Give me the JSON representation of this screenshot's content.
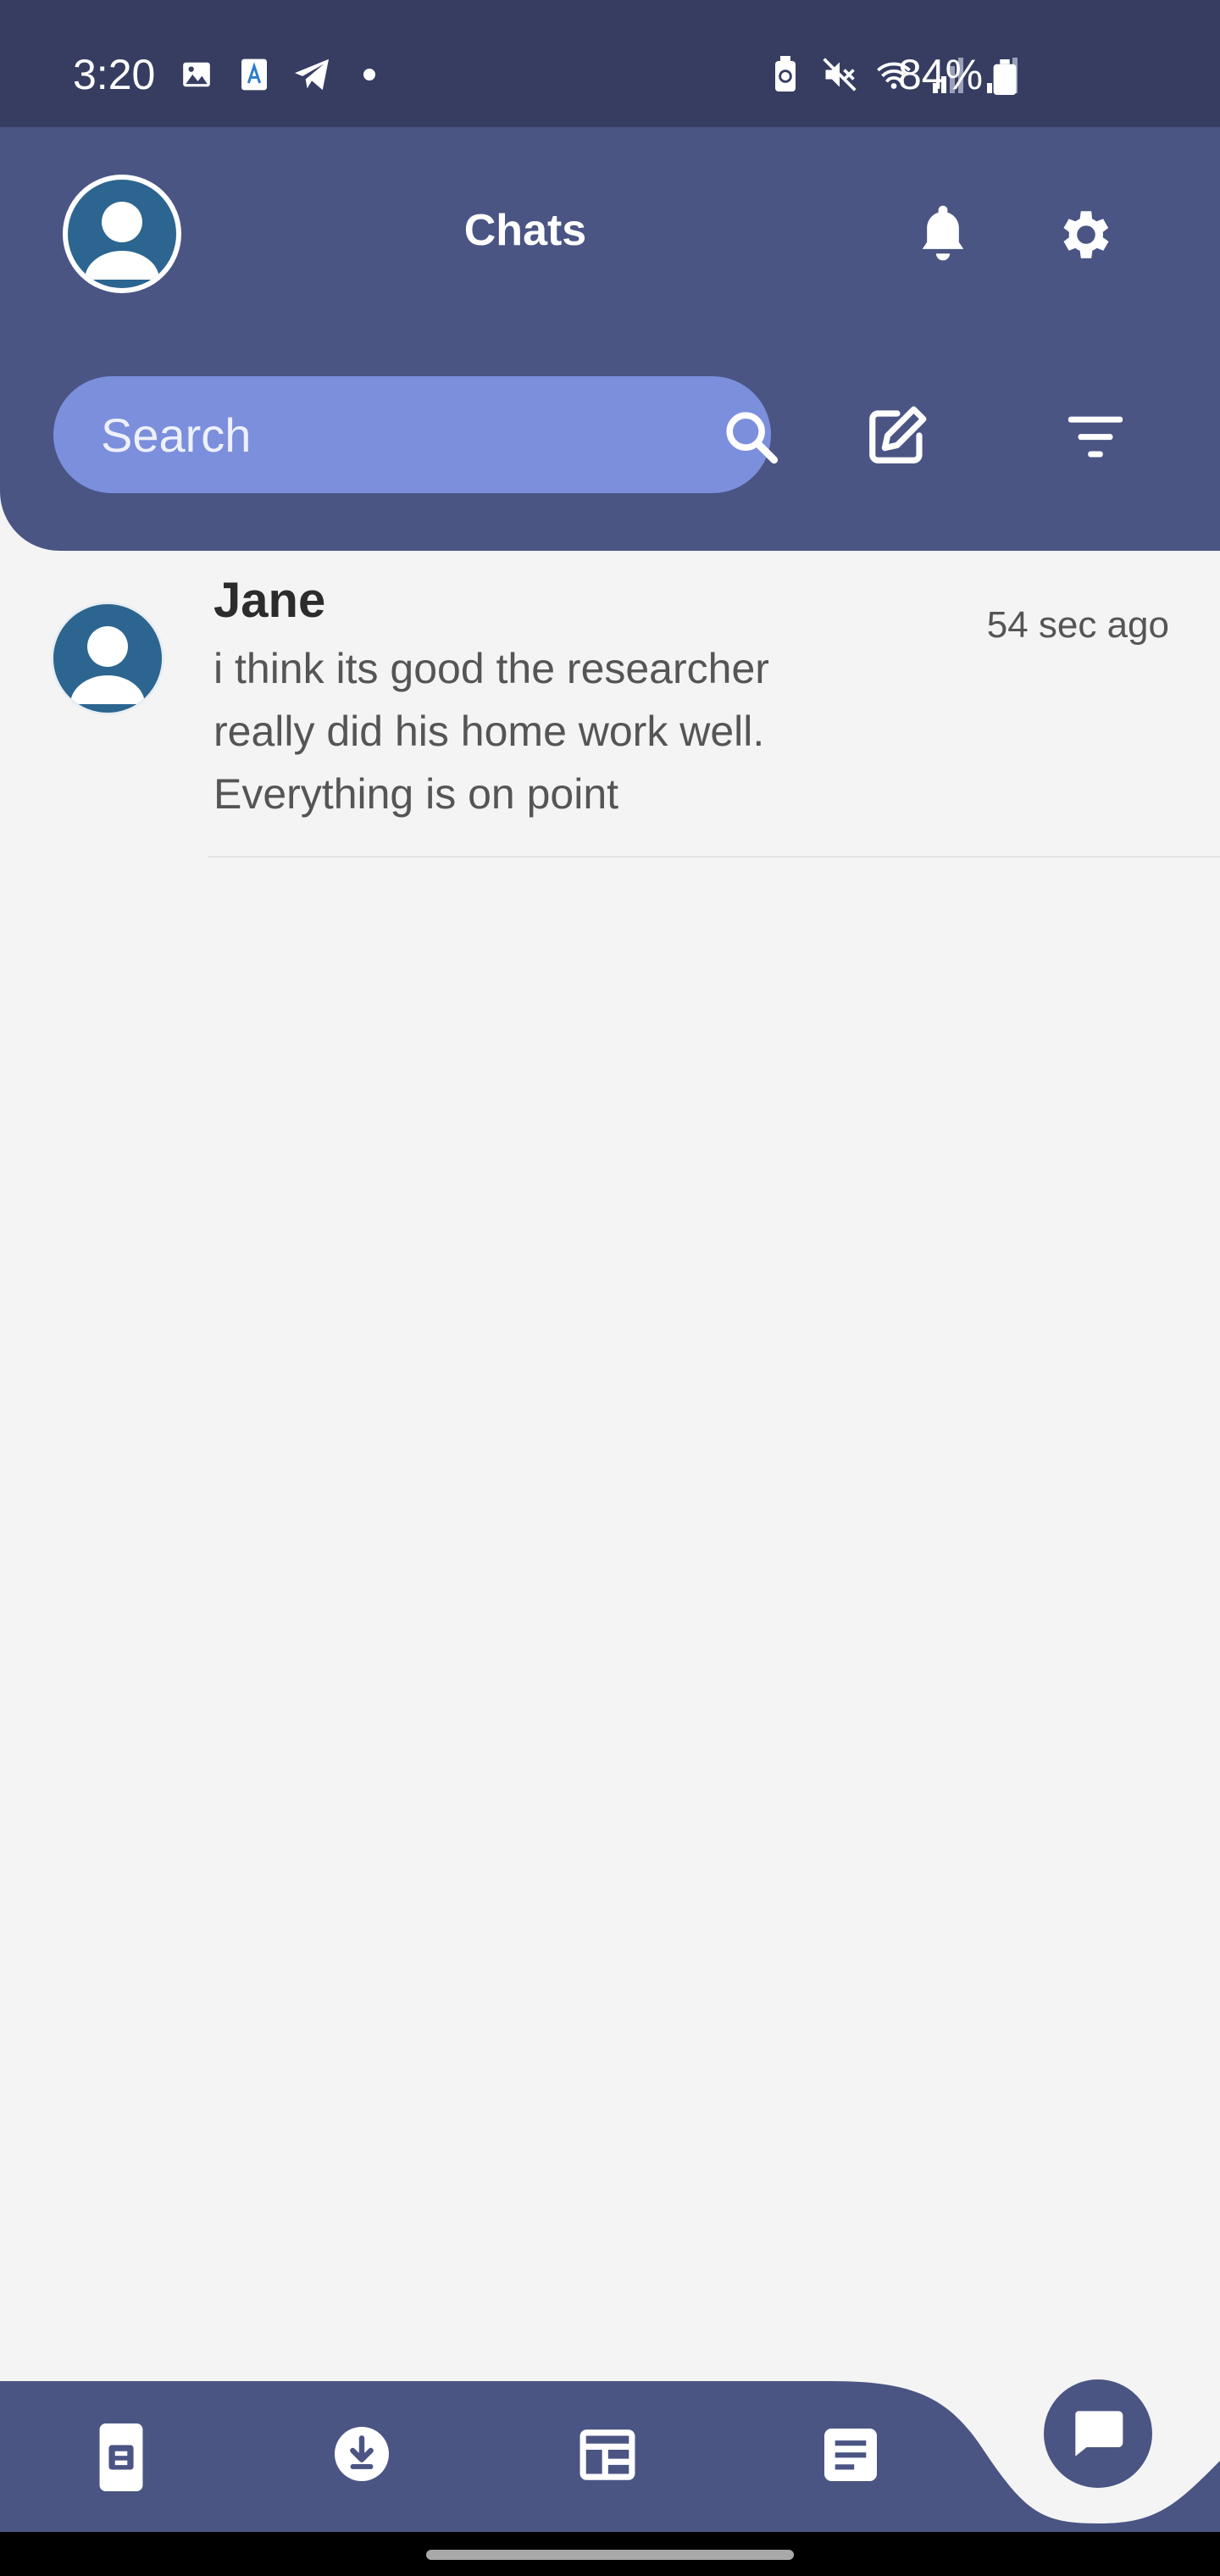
{
  "status_bar": {
    "time": "3:20",
    "battery": "84%",
    "left_icons": [
      "gallery-icon",
      "app-notification-icon",
      "telegram-icon",
      "dot-icon"
    ],
    "right_icons": [
      "battery-saver-icon",
      "mute-icon",
      "wifi-icon",
      "signal-icon",
      "signal-icon"
    ]
  },
  "header": {
    "title": "Chats",
    "search": {
      "placeholder": "Search"
    }
  },
  "chats": [
    {
      "name": "Jane",
      "time": "54 sec ago",
      "preview": "i think its good the researcher really did his home work well. Everything is on point"
    }
  ],
  "bottom_nav": {
    "items": [
      "contacts-card-icon",
      "download-icon",
      "feed-icon",
      "notes-icon"
    ],
    "active": "chat-bubble-icon"
  },
  "colors": {
    "header": "#4a5584",
    "status_bar": "#363d61",
    "search": "#7b8fdc",
    "background": "#f4f4f4",
    "avatar": "#2c6590"
  }
}
